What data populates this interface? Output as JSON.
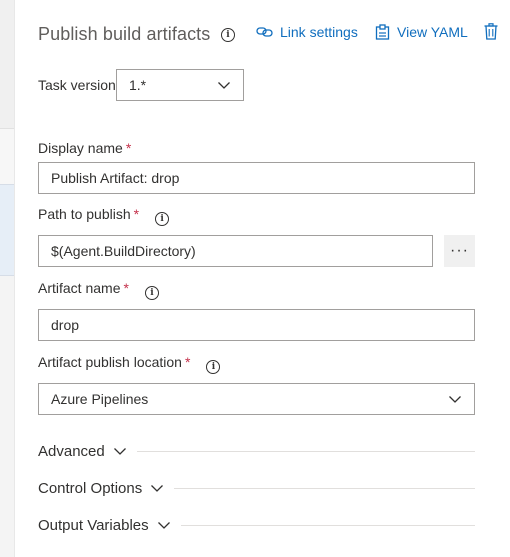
{
  "header": {
    "title": "Publish build artifacts",
    "link_settings": "Link settings",
    "view_yaml": "View YAML"
  },
  "task_version": {
    "label": "Task version",
    "value": "1.*"
  },
  "display_name": {
    "label": "Display name",
    "required_mark": "*",
    "value": "Publish Artifact: drop"
  },
  "path_to_publish": {
    "label": "Path to publish",
    "required_mark": "*",
    "value": "$(Agent.BuildDirectory)",
    "browse_label": "···"
  },
  "artifact_name": {
    "label": "Artifact name",
    "required_mark": "*",
    "value": "drop"
  },
  "artifact_publish_location": {
    "label": "Artifact publish location",
    "required_mark": "*",
    "value": "Azure Pipelines"
  },
  "sections": {
    "advanced": "Advanced",
    "control_options": "Control Options",
    "output_variables": "Output Variables"
  },
  "info_glyph": "i",
  "colors": {
    "link": "#106ebe",
    "required": "#c4314b",
    "border": "#a19f9d"
  },
  "icons": {
    "link": "link-icon",
    "yaml": "clipboard-icon",
    "delete": "trash-icon",
    "info": "info-icon",
    "chevron": "chevron-down-icon"
  }
}
